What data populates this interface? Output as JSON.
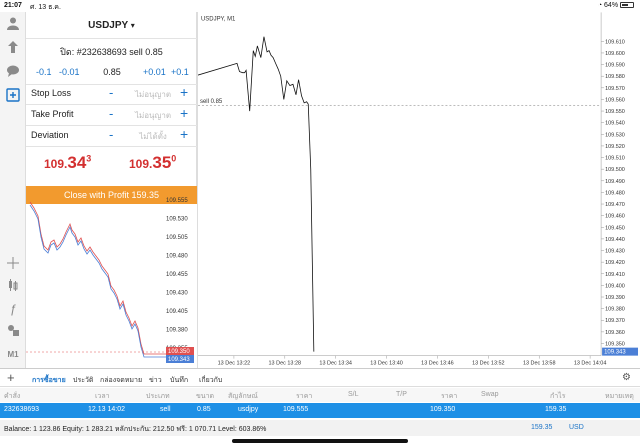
{
  "status_bar": {
    "time": "21:07",
    "date": "ศ. 13 ธ.ค.",
    "battery": "64%",
    "battery_level": 0.64
  },
  "toolbar": {
    "icons": [
      "user-icon",
      "tree-icon",
      "chat-icon",
      "new-order-icon",
      "crosshair-icon",
      "candles-icon",
      "function-icon",
      "objects-icon",
      "timeframe-icon"
    ],
    "timeframe_label": "M1"
  },
  "order_panel": {
    "symbol": "USDJPY",
    "dropdown_glyph": "▾",
    "order_text": "ปิด: #232638693 sell 0.85",
    "steps": {
      "minus_large": "-0.1",
      "minus_small": "-0.01",
      "value": "0.85",
      "plus_small": "+0.01",
      "plus_large": "+0.1"
    },
    "stop_loss": {
      "label": "Stop Loss",
      "placeholder": "ไม่อนุญาต"
    },
    "take_profit": {
      "label": "Take Profit",
      "placeholder": "ไม่อนุญาต"
    },
    "deviation": {
      "label": "Deviation",
      "placeholder": "ไม่ได้ตั้ง"
    },
    "minus_glyph": "-",
    "plus_glyph": "+",
    "bid": {
      "big": "109.",
      "main": "34",
      "small": "3"
    },
    "ask": {
      "big": "109.",
      "main": "35",
      "small": "0"
    },
    "close_button": "Close with Profit 159.35"
  },
  "mini_chart": {
    "y_ticks": [
      "109.555",
      "109.530",
      "109.505",
      "109.480",
      "109.455",
      "109.430",
      "109.405",
      "109.380",
      "109.355"
    ],
    "bid_tag": "109.350",
    "ask_tag": "109.343"
  },
  "chart_data": {
    "type": "line",
    "title": "USDJPY, M1",
    "x": [
      "13 Dec 13:22",
      "13 Dec 13:28",
      "13 Dec 13:34",
      "13 Dec 13:40",
      "13 Dec 13:46",
      "13 Dec 13:52",
      "13 Dec 13:58",
      "13 Dec 14:04"
    ],
    "y_ticks": [
      "109.610",
      "109.600",
      "109.590",
      "109.580",
      "109.570",
      "109.560",
      "109.550",
      "109.540",
      "109.530",
      "109.520",
      "109.510",
      "109.500",
      "109.490",
      "109.480",
      "109.470",
      "109.460",
      "109.450",
      "109.440",
      "109.430",
      "109.420",
      "109.410",
      "109.400",
      "109.390",
      "109.380",
      "109.370",
      "109.360",
      "109.350"
    ],
    "ylim": [
      109.343,
      109.616
    ],
    "sell_level": {
      "label": "sell 0.85",
      "value": 109.555
    },
    "current_price_tag": "109.343",
    "series": [
      {
        "values": [
          109.581,
          109.591,
          109.584,
          109.583,
          109.583,
          109.585,
          109.55,
          109.602,
          109.597,
          109.606,
          109.596,
          109.614,
          109.601,
          109.602,
          109.598,
          109.596,
          109.591,
          109.586,
          109.58,
          109.56,
          109.576,
          109.572,
          109.573,
          109.564,
          109.577,
          109.563,
          109.557,
          109.558,
          109.556,
          109.5,
          109.343
        ],
        "x_positions": [
          0,
          0.06,
          0.11,
          0.17,
          0.21,
          0.24,
          0.31,
          0.38,
          0.42,
          0.46,
          0.53,
          0.59,
          0.65,
          0.69,
          0.73,
          0.77,
          0.82,
          0.87,
          0.92,
          0.98,
          1.04,
          1.1,
          1.16,
          1.22,
          1.27,
          1.33,
          1.38,
          1.43,
          1.46,
          1.51,
          1.57
        ]
      }
    ]
  },
  "tabs": {
    "items": [
      "การซื้อขาย",
      "ประวัติ",
      "กล่องจดหมาย",
      "ข่าว",
      "บันทึก",
      "เกี่ยวกับ"
    ],
    "active": 0,
    "add": "+",
    "settings": "⚙"
  },
  "table": {
    "headers": [
      "คำสั่ง",
      "เวลา",
      "ประเภท",
      "ขนาด",
      "สัญลักษณ์",
      "ราคา",
      "S/L",
      "T/P",
      "ราคา",
      "Swap",
      "กำไร",
      "หมายเหตุ"
    ],
    "row": [
      "232638693",
      "12.13 14:02",
      "sell",
      "0.85",
      "usdjpy",
      "109.555",
      "",
      "",
      "109.350",
      "",
      "159.35",
      ""
    ]
  },
  "footer": {
    "balance_text": "Balance: 1 123.86 Equity: 1 283.21 หลักประกัน: 212.50 ฟรี: 1 070.71 Level: 603.86%",
    "profit": "159.35",
    "currency": "USD"
  }
}
